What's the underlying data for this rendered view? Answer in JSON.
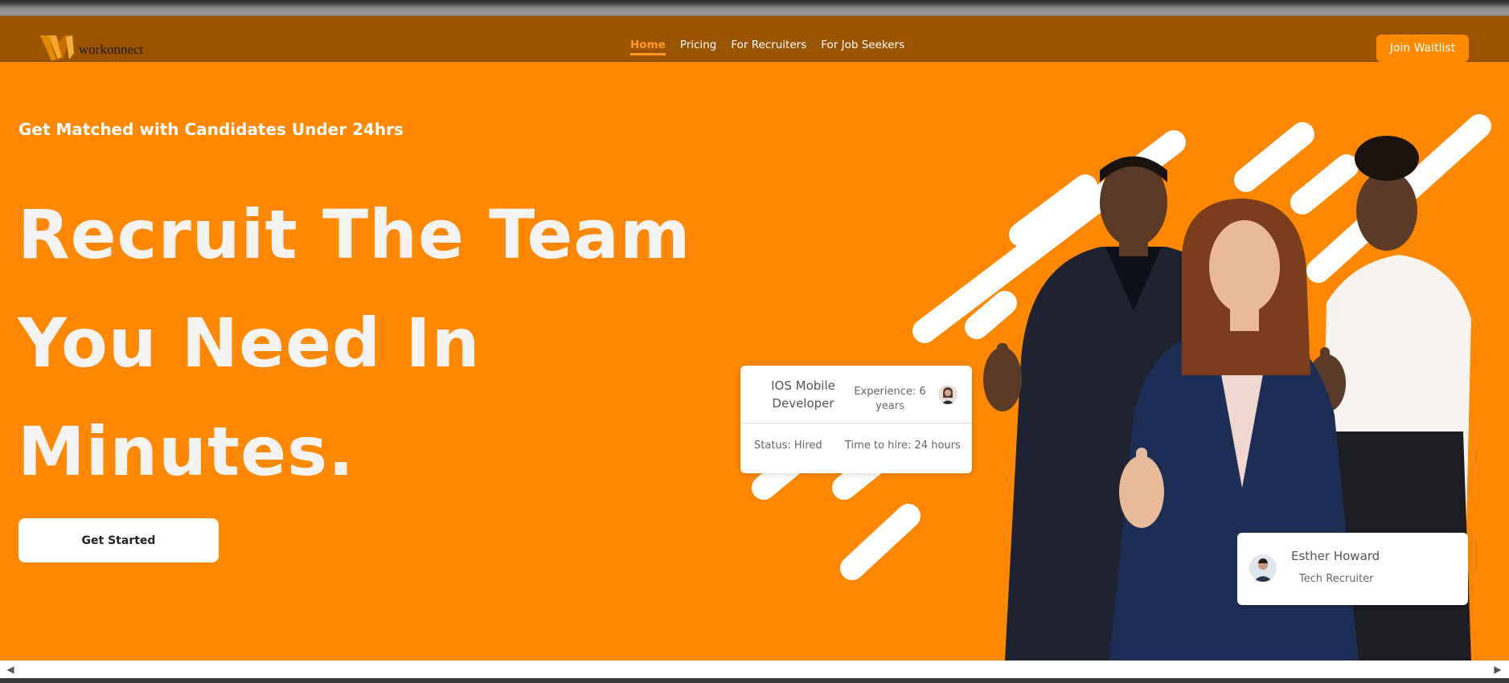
{
  "brand": {
    "name": "workonnect",
    "accent": "#ff8800",
    "nav_bg": "#9a5400"
  },
  "nav": {
    "links": [
      {
        "label": "Home",
        "active": true
      },
      {
        "label": "Pricing",
        "active": false
      },
      {
        "label": "For Recruiters",
        "active": false
      },
      {
        "label": "For Job Seekers",
        "active": false
      }
    ],
    "cta": "Join Waitlist"
  },
  "hero": {
    "tagline": "Get Matched with Candidates Under 24hrs",
    "headline": [
      "Recruit The Team",
      "You Need In",
      "Minutes."
    ],
    "cta": "Get Started"
  },
  "job_card": {
    "role": "IOS Mobile Developer",
    "experience": "Experience: 6 years",
    "status": "Status: Hired",
    "time_to_hire": "Time to hire: 24 hours"
  },
  "recruiter_card": {
    "name": "Esther Howard",
    "title": "Tech Recruiter"
  },
  "icons": {
    "logo": "workonnect-logo-icon",
    "scroll_left": "scroll-left-arrow-icon",
    "scroll_right": "scroll-right-arrow-icon"
  }
}
